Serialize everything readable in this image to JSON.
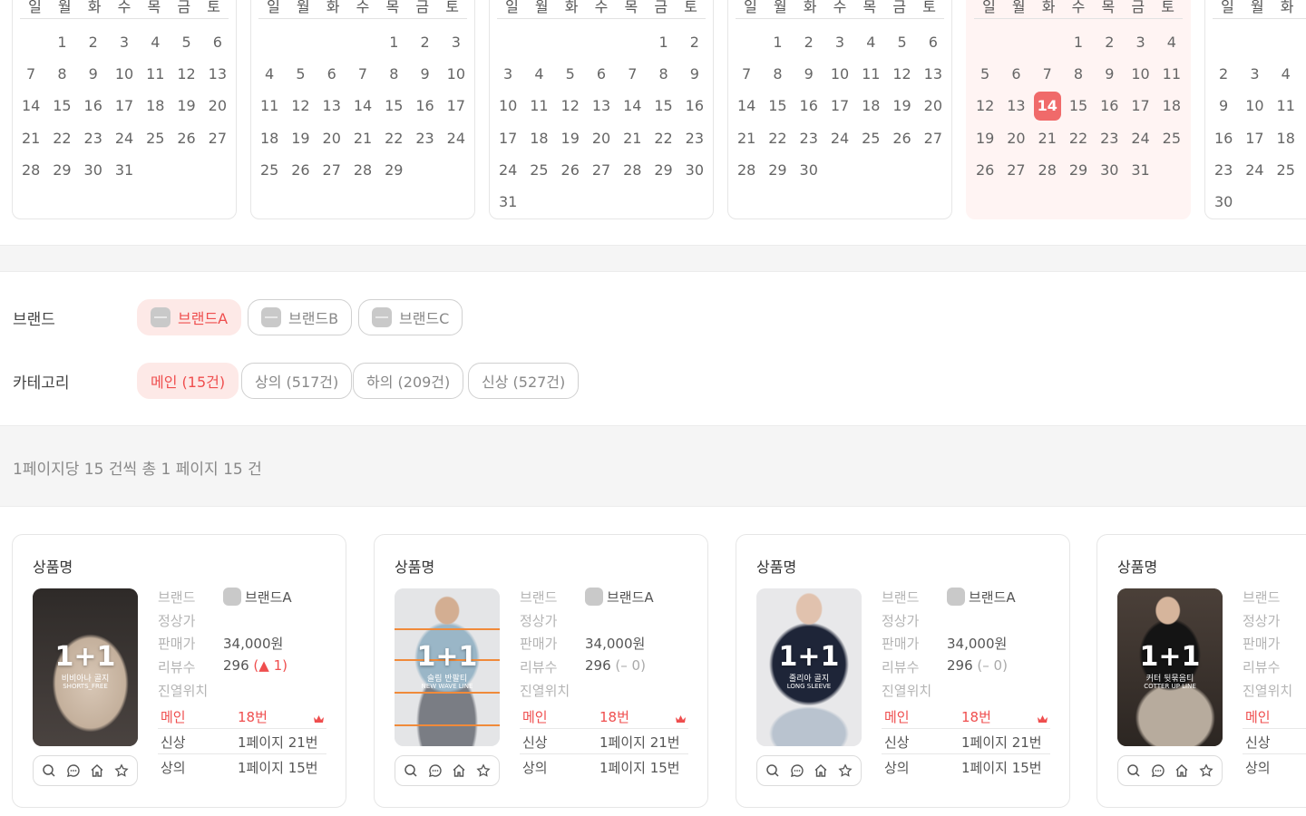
{
  "calendar": {
    "weekdays": [
      "일",
      "월",
      "화",
      "수",
      "목",
      "금",
      "토"
    ],
    "months": [
      {
        "offset": 1,
        "days": 31,
        "today": null,
        "active": false
      },
      {
        "offset": 4,
        "days": 29,
        "today": null,
        "active": false
      },
      {
        "offset": 5,
        "days": 31,
        "today": null,
        "active": false
      },
      {
        "offset": 1,
        "days": 30,
        "today": null,
        "active": false
      },
      {
        "offset": 3,
        "days": 31,
        "today": 14,
        "active": true
      },
      {
        "offset": 6,
        "days": 30,
        "today": null,
        "active": false
      }
    ]
  },
  "filters": {
    "brand_label": "브랜드",
    "brands": [
      {
        "label": "브랜드A",
        "selected": true
      },
      {
        "label": "브랜드B",
        "selected": false
      },
      {
        "label": "브랜드C",
        "selected": false
      }
    ],
    "category_label": "카테고리",
    "categories": [
      {
        "label": "메인 (15건)",
        "selected": true
      },
      {
        "label": "상의 (517건)",
        "selected": false
      },
      {
        "label": "하의 (209건)",
        "selected": false
      },
      {
        "label": "신상 (527건)",
        "selected": false
      }
    ]
  },
  "summary": "1페이지당 15 건씩 총 1 페이지 15 건",
  "field_labels": {
    "brand": "브랜드",
    "list_price": "정상가",
    "sale_price": "판매가",
    "reviews": "리뷰수",
    "display": "진열위치"
  },
  "products": [
    {
      "title": "상품명",
      "thumb_big": "1+1",
      "thumb_sub1": "비비아나 골지",
      "thumb_sub2": "SHORTS_FREE",
      "brand": "브랜드A",
      "list_price": "",
      "sale_price": "34,000원",
      "reviews": "296",
      "review_change": "▲ 1",
      "rank_main_label": "메인",
      "rank_main_value": "18번",
      "rank_new_label": "신상",
      "rank_new_value": "1페이지 21번",
      "rank_top_label": "상의",
      "rank_top_value": "1페이지 15번"
    },
    {
      "title": "상품명",
      "thumb_big": "1+1",
      "thumb_sub1": "슬림 반팔티",
      "thumb_sub2": "NEW WAVE LINE",
      "brand": "브랜드A",
      "list_price": "",
      "sale_price": "34,000원",
      "reviews": "296",
      "review_change": "– 0",
      "rank_main_label": "메인",
      "rank_main_value": "18번",
      "rank_new_label": "신상",
      "rank_new_value": "1페이지 21번",
      "rank_top_label": "상의",
      "rank_top_value": "1페이지 15번"
    },
    {
      "title": "상품명",
      "thumb_big": "1+1",
      "thumb_sub1": "줄리아 골지",
      "thumb_sub2": "LONG SLEEVE",
      "brand": "브랜드A",
      "list_price": "",
      "sale_price": "34,000원",
      "reviews": "296",
      "review_change": "– 0",
      "rank_main_label": "메인",
      "rank_main_value": "18번",
      "rank_new_label": "신상",
      "rank_new_value": "1페이지 21번",
      "rank_top_label": "상의",
      "rank_top_value": "1페이지 15번"
    },
    {
      "title": "상품명",
      "thumb_big": "1+1",
      "thumb_sub1": "커터 뒷묶음티",
      "thumb_sub2": "COTTER UP LINE",
      "brand": "",
      "list_price": "",
      "sale_price": "",
      "reviews": "",
      "review_change": "",
      "rank_main_label": "메인",
      "rank_main_value": "",
      "rank_new_label": "신상",
      "rank_new_value": "",
      "rank_top_label": "상의",
      "rank_top_value": ""
    }
  ],
  "colors": {
    "accent": "#ef4e4e",
    "accent_bg": "#fde9e7",
    "today": "#f06a6a",
    "active_month_bg": "#fff4f3"
  },
  "icons": [
    "search-icon",
    "chat-icon",
    "home-icon",
    "star-icon",
    "crown-icon"
  ]
}
